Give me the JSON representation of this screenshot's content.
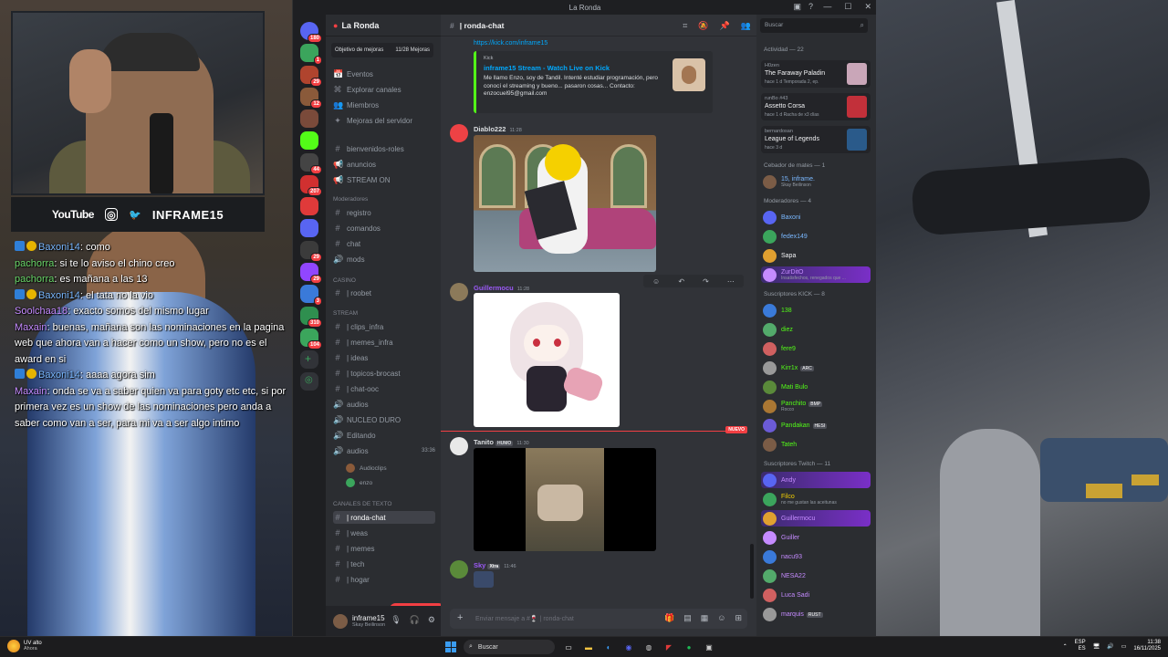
{
  "overlay": {
    "socials": {
      "youtube": "YouTube",
      "handle": "INFRAME15"
    },
    "chat": [
      {
        "user": "Baxoni14",
        "color": "#7ab8ff",
        "badges": [
          "blue",
          "gold"
        ],
        "text": ": como"
      },
      {
        "user": "pachorra",
        "color": "#6bd96b",
        "badges": [],
        "text": ": si te lo aviso el chino creo"
      },
      {
        "user": "pachorra",
        "color": "#6bd96b",
        "badges": [],
        "text": ": es mañana a las 13"
      },
      {
        "user": "Baxoni14",
        "color": "#7ab8ff",
        "badges": [
          "blue",
          "gold"
        ],
        "text": ": el tata no la vio"
      },
      {
        "user": "Soolchaa18",
        "color": "#c58bff",
        "badges": [],
        "text": ": exacto somos del mismo lugar"
      },
      {
        "user": "Maxain",
        "color": "#c58bff",
        "badges": [],
        "text": ": buenas, mañana son las nominaciones en la pagina web que ahora van a hacer como un show, pero no es el award en si"
      },
      {
        "user": "Baxoni14",
        "color": "#7ab8ff",
        "badges": [
          "blue",
          "gold"
        ],
        "text": ": aaaa agora sim"
      },
      {
        "user": "Maxain",
        "color": "#c58bff",
        "badges": [],
        "text": ": onda se va a saber quien va para goty etc etc, si por primera vez es un show de las nominaciones pero anda a saber como van a ser, para mi va a ser algo intimo"
      }
    ]
  },
  "window": {
    "title": "La Ronda",
    "controls": [
      "—",
      "☐",
      "✕"
    ]
  },
  "servers": [
    {
      "color": "#5865f2",
      "badge": "180"
    },
    {
      "color": "#3ba55c",
      "badge": "1"
    },
    {
      "color": "#b0442e",
      "badge": "29"
    },
    {
      "color": "#8a5a3a",
      "badge": "12"
    },
    {
      "color": "#7a4a3a",
      "badge": ""
    },
    {
      "color": "#53fc18",
      "badge": ""
    },
    {
      "color": "#444",
      "badge": "44"
    },
    {
      "color": "#d13030",
      "badge": "207"
    },
    {
      "color": "#e03a3a",
      "badge": ""
    },
    {
      "color": "#5865f2",
      "badge": ""
    },
    {
      "color": "#3b3b3b",
      "badge": "29"
    },
    {
      "color": "#9146ff",
      "badge": "29"
    },
    {
      "color": "#3a7ad9",
      "badge": "3"
    },
    {
      "color": "#2f8f4f",
      "badge": "310"
    },
    {
      "color": "#3ba55c",
      "badge": "104"
    },
    {
      "color": "#313338",
      "badge": ""
    },
    {
      "color": "#313338",
      "badge": ""
    }
  ],
  "sidebar": {
    "server_name": "La Ronda",
    "boost_label": "Objetivo de mejoras",
    "boost_value": "11/28 Mejoras",
    "items": [
      {
        "icon": "📅",
        "label": "Eventos"
      },
      {
        "icon": "⌘",
        "label": "Explorar canales"
      },
      {
        "icon": "👥",
        "label": "Miembros"
      },
      {
        "icon": "✦",
        "label": "Mejoras del servidor"
      }
    ],
    "channels_top": [
      {
        "icon": "#",
        "label": "bienvenidos-roles"
      },
      {
        "icon": "📢",
        "label": "anuncios"
      },
      {
        "icon": "📢",
        "label": "STREAM ON"
      }
    ],
    "cat_mods": "Moderadores",
    "channels_mods": [
      {
        "icon": "#",
        "label": "registro"
      },
      {
        "icon": "#",
        "label": "comandos"
      },
      {
        "icon": "#",
        "label": "chat"
      },
      {
        "icon": "🔊",
        "label": "mods"
      }
    ],
    "cat_casino": "CASINO",
    "channels_casino": [
      {
        "icon": "#",
        "label": "| roobet"
      }
    ],
    "cat_stream": "STREAM",
    "channels_stream": [
      {
        "icon": "#",
        "label": "| clips_infra"
      },
      {
        "icon": "#",
        "label": "| memes_infra"
      },
      {
        "icon": "#",
        "label": "| ideas"
      },
      {
        "icon": "#",
        "label": "| topicos-brocast"
      },
      {
        "icon": "#",
        "label": "| chat-ooc"
      },
      {
        "icon": "🔊",
        "label": "audios"
      },
      {
        "icon": "🔊",
        "label": "NUCLEO DURO"
      },
      {
        "icon": "🔊",
        "label": "Editando"
      },
      {
        "icon": "🔊",
        "label": "audios",
        "extra": "33:36"
      }
    ],
    "voice_users": [
      "Audioclips",
      "enzo"
    ],
    "cat_text": "CANALES DE TEXTO",
    "channels_text": [
      {
        "icon": "#",
        "label": "| ronda-chat",
        "active": true
      },
      {
        "icon": "#",
        "label": "| weas"
      },
      {
        "icon": "#",
        "label": "| memes"
      },
      {
        "icon": "#",
        "label": "| tech"
      },
      {
        "icon": "#",
        "label": "| hogar"
      }
    ],
    "new_mention": "1 MENCIÓN NUEVA",
    "user": {
      "name": "inframe15",
      "status": "Skay Beilinson"
    }
  },
  "main": {
    "channel": "| ronda-chat",
    "link": "https://kick.com/inframe15",
    "embed": {
      "site": "Kick",
      "title": "inframe15 Stream - Watch Live on Kick",
      "description": "Me llamo Enzo, soy de Tandil. Intenté estudiar programación, pero conocí el streaming y bueno... pasaron cosas... Contacto: enzocuel95@gmail.com"
    },
    "messages": [
      {
        "user": "Diablo222",
        "time": "11:28",
        "color": "#f2f3f5"
      },
      {
        "user": "Guillermocu",
        "time": "11:28",
        "color": "#9b59f6"
      },
      {
        "user": "Tanito",
        "time": "11:30",
        "color": "#f2f3f5",
        "tag": "HUMO"
      },
      {
        "user": "Sky",
        "time": "11:46",
        "color": "#9b59f6",
        "tag": "Xtra"
      }
    ],
    "new_label": "NUEVO",
    "composer_placeholder": "Enviar mensaje a #🍷 | ronda-chat"
  },
  "members": {
    "search_placeholder": "Buscar",
    "activity_header": "Actividad — 22",
    "activities": [
      {
        "user": "H0zen",
        "title": "The Faraway Paladin",
        "sub": "hace 1 d  Temporada 2, ep."
      },
      {
        "user": "runBo #43",
        "title": "Assetto Corsa",
        "sub": "hace 1 d  Racha de x3 días"
      },
      {
        "user": "bernardosan",
        "title": "League of Legends",
        "sub": "hace 3 d"
      }
    ],
    "sections": [
      {
        "title": "Cebador de mates — 1",
        "members": [
          {
            "name": "15, inframe.",
            "sub": "Skay Beilinson",
            "color": "#7ab8ff"
          }
        ]
      },
      {
        "title": "Moderadores — 4",
        "members": [
          {
            "name": "Baxoni",
            "color": "#7ab8ff"
          },
          {
            "name": "fedex149",
            "color": "#7ab8ff"
          },
          {
            "name": "Sapa",
            "color": "#f2f3f5"
          },
          {
            "name": "ZurDitO",
            "sub": "Insatisfechos, renegados que ...",
            "color": "#c58bff",
            "hl": true
          }
        ]
      },
      {
        "title": "Suscriptores KICK — 8",
        "members": [
          {
            "name": "138",
            "color": "#53fc18"
          },
          {
            "name": "diez",
            "color": "#53fc18"
          },
          {
            "name": "fere9",
            "color": "#53fc18"
          },
          {
            "name": "Kirr1x",
            "tag": "ARC",
            "color": "#53fc18"
          },
          {
            "name": "Mati Bulo",
            "color": "#53fc18"
          },
          {
            "name": "Panchito",
            "tag": "BMP",
            "sub": "Rocco",
            "color": "#53fc18"
          },
          {
            "name": "Pandakan",
            "tag": "HESI",
            "color": "#53fc18"
          },
          {
            "name": "Tateh",
            "color": "#53fc18"
          }
        ]
      },
      {
        "title": "Suscriptores Twitch — 11",
        "members": [
          {
            "name": "Andy",
            "color": "#c58bff",
            "hl": true
          },
          {
            "name": "Filco",
            "sub": "no me gustan las aceitunas",
            "color": "#f5d000"
          },
          {
            "name": "Guillermocu",
            "color": "#c58bff",
            "hl": true
          },
          {
            "name": "Guiller",
            "color": "#c58bff"
          },
          {
            "name": "nacu93",
            "color": "#c58bff"
          },
          {
            "name": "NESA22",
            "color": "#c58bff"
          },
          {
            "name": "Luca Sadi",
            "color": "#c58bff"
          },
          {
            "name": "marquis",
            "tag": "RUST",
            "color": "#c58bff"
          }
        ]
      }
    ]
  },
  "taskbar": {
    "weather_temp": "UV alto",
    "weather_sub": "Ahora",
    "search": "Buscar",
    "lang1": "ESP",
    "lang2": "ES",
    "time": "11:38",
    "date": "16/11/2025"
  }
}
